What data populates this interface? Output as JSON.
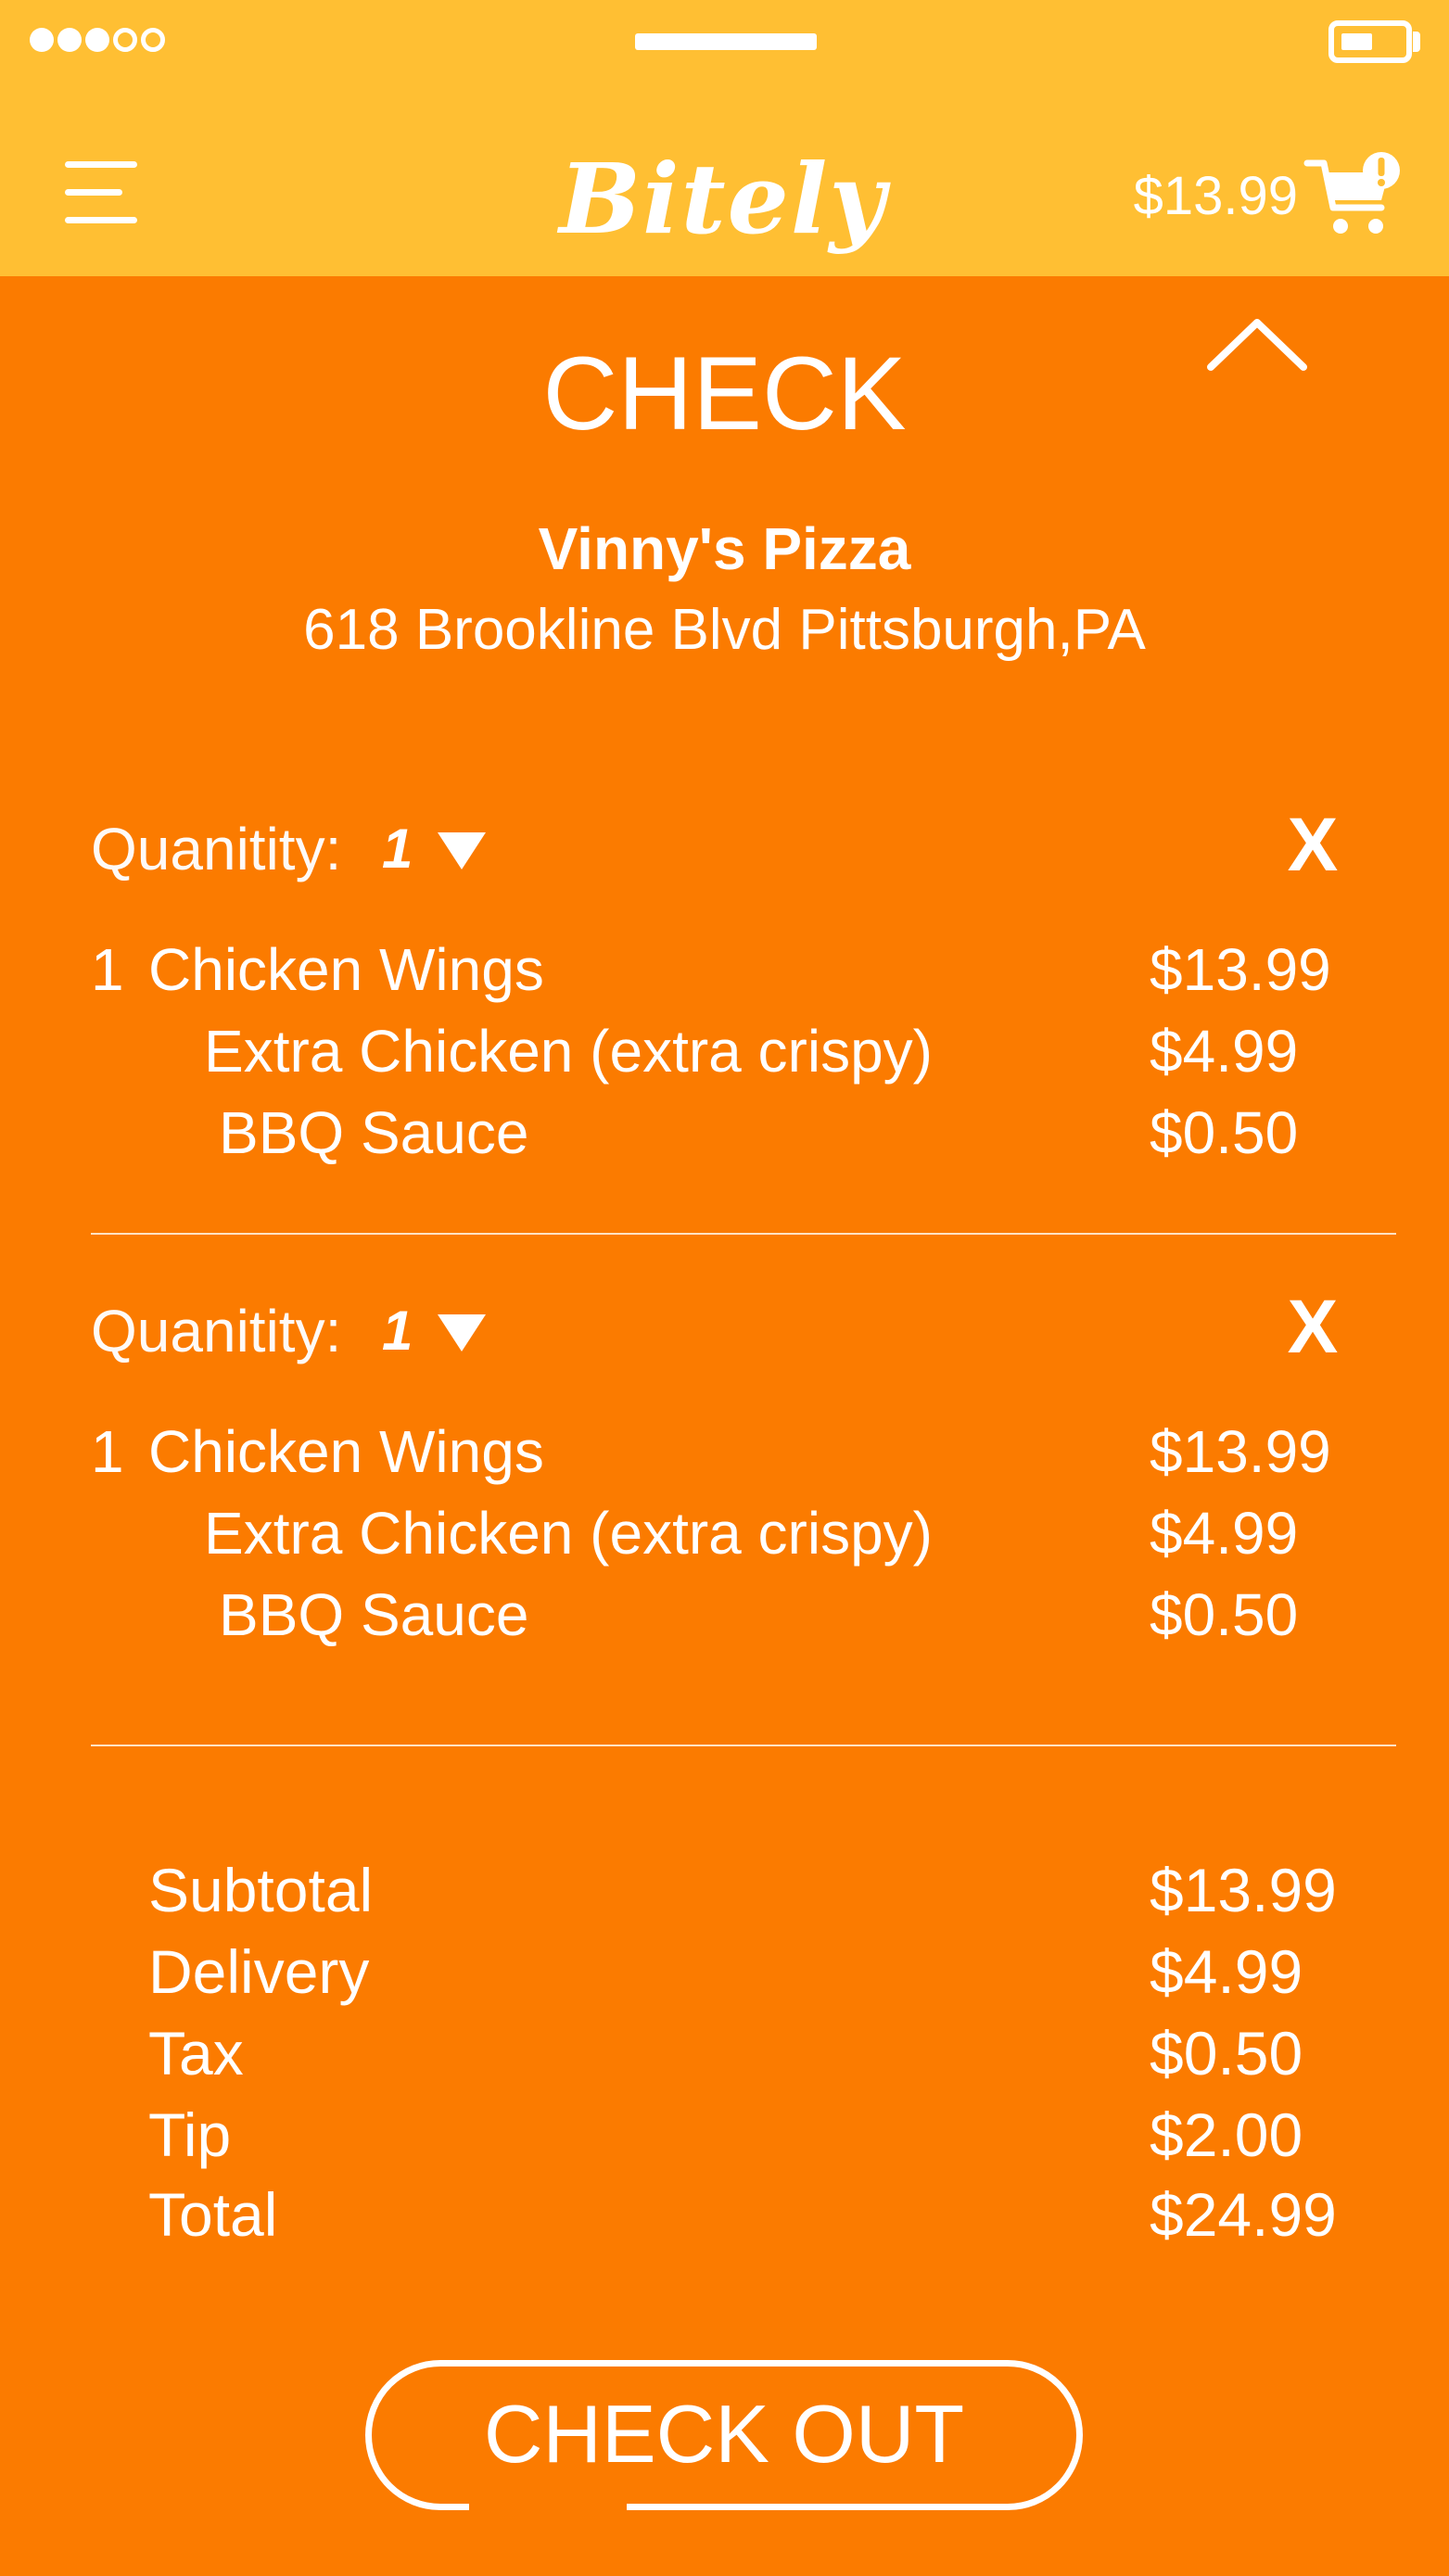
{
  "status_bar": {
    "signal_dots_total": 5,
    "signal_dots_filled": 3,
    "battery_level": 0.5
  },
  "header": {
    "menu_icon": "hamburger-menu-icon",
    "logo": "Bitely",
    "cart_total": "$13.99",
    "cart_icon": "shopping-cart-alert-icon",
    "brand_color": "#FFBF33"
  },
  "check": {
    "title": "CHECK",
    "collapse_icon": "chevron-up-icon",
    "restaurant_name": "Vinny's Pizza",
    "restaurant_address": "618 Brookline Blvd Pittsburgh,PA",
    "background_color": "#FB7B00"
  },
  "order_items": [
    {
      "quantity_label": "Quanitity:",
      "quantity_value": "1",
      "remove_label": "X",
      "item_qty": "1",
      "item_name": "Chicken Wings",
      "item_price": "$13.99",
      "options": [
        {
          "name": "Extra Chicken (extra crispy)",
          "price": "$4.99"
        },
        {
          "name": "BBQ Sauce",
          "price": "$0.50"
        }
      ]
    },
    {
      "quantity_label": "Quanitity:",
      "quantity_value": "1",
      "remove_label": "X",
      "item_qty": "1",
      "item_name": "Chicken Wings",
      "item_price": "$13.99",
      "options": [
        {
          "name": "Extra Chicken (extra crispy)",
          "price": "$4.99"
        },
        {
          "name": "BBQ Sauce",
          "price": "$0.50"
        }
      ]
    }
  ],
  "summary": [
    {
      "label": "Subtotal",
      "value": "$13.99"
    },
    {
      "label": "Delivery",
      "value": "$4.99"
    },
    {
      "label": "Tax",
      "value": "$0.50"
    },
    {
      "label": "Tip",
      "value": "$2.00"
    },
    {
      "label": "Total",
      "value": "$24.99"
    }
  ],
  "checkout_label": "CHECK OUT"
}
